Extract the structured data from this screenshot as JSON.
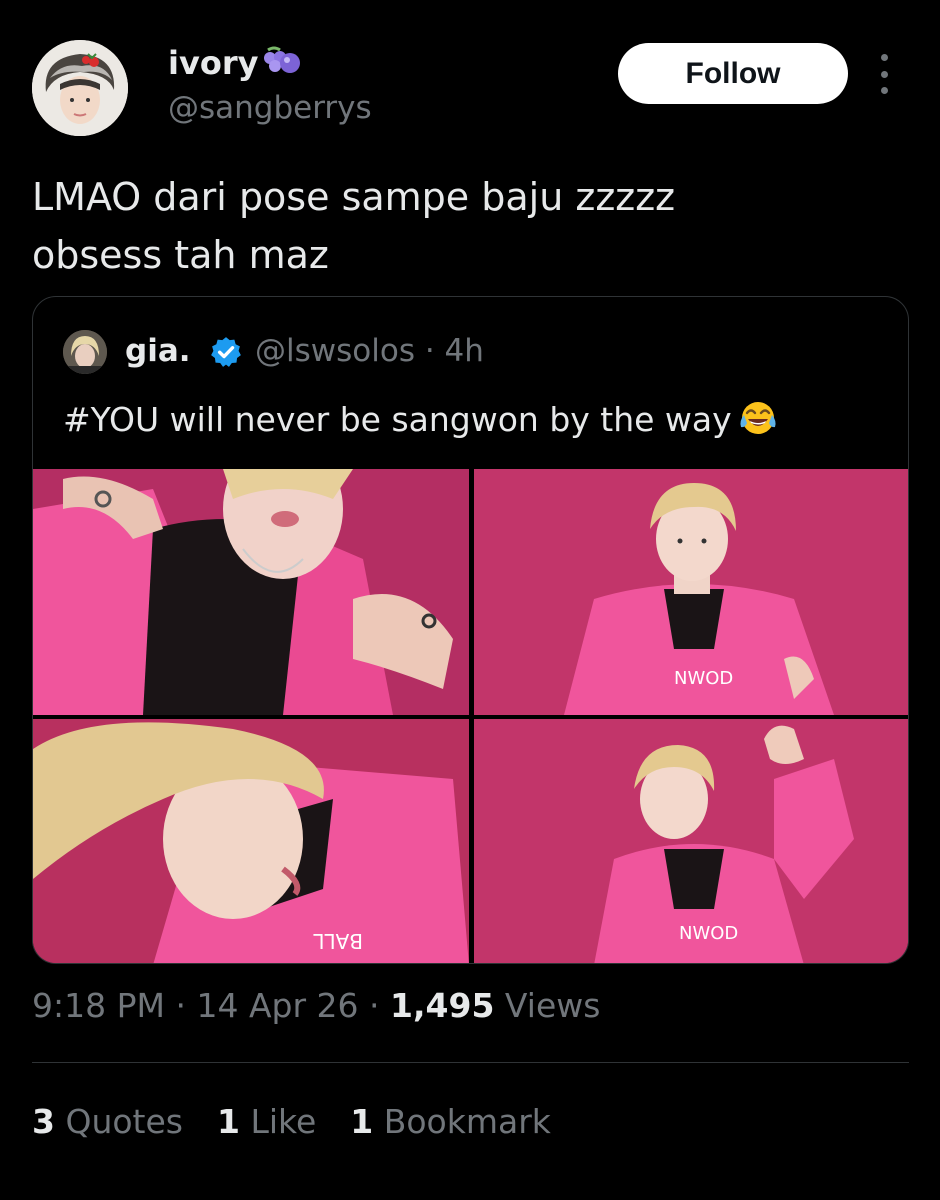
{
  "tweet": {
    "author": {
      "display_name": "ivory",
      "handle": "@sangberrys",
      "name_badge_icon": "grapes-icon"
    },
    "follow_label": "Follow",
    "text_lines": [
      "LMAO dari pose sampe baju zzzzz",
      "obsess tah maz"
    ],
    "quote": {
      "display_name": "gia.",
      "verified": true,
      "handle": "@lswsolos",
      "separator": "·",
      "age": "4h",
      "text": "#YOU will never be sangwon by the way",
      "emoji": "face-with-tears-of-joy",
      "photos": [
        {
          "alt": "person in pink hoodie making a hand gesture near face"
        },
        {
          "alt": "blond person in pink hoodie against magenta wall"
        },
        {
          "alt": "close-up of blond person tilting head in pink hoodie"
        },
        {
          "alt": "blond person in pink hoodie waving arm raised"
        }
      ]
    },
    "time": "9:18 PM",
    "dot": "·",
    "date": "14 Apr 26",
    "views_count": "1,495",
    "views_label": "Views",
    "stats": {
      "quotes_count": "3",
      "quotes_label": "Quotes",
      "likes_count": "1",
      "likes_label": "Like",
      "bookmarks_count": "1",
      "bookmarks_label": "Bookmark"
    }
  },
  "colors": {
    "background": "#000000",
    "text_primary": "#e7e9ea",
    "text_secondary": "#71767b",
    "border": "#2f3336",
    "verified_blue": "#1d9bf0",
    "photo_backdrop": "#c2356a",
    "hoodie_pink": "#f0559c"
  }
}
